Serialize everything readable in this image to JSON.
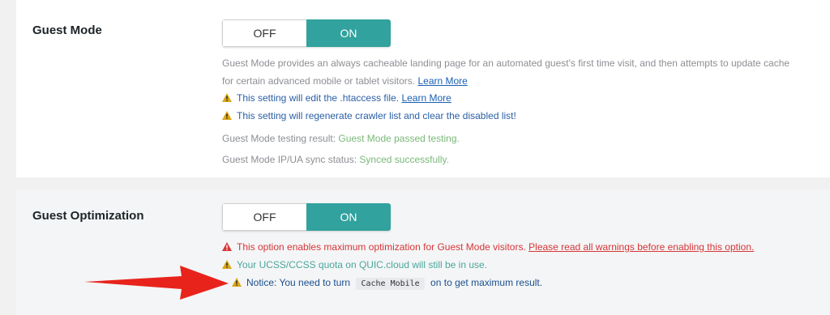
{
  "guest_mode": {
    "label": "Guest Mode",
    "toggle": {
      "off": "OFF",
      "on": "ON",
      "selected": "ON"
    },
    "desc_line1": "Guest Mode provides an always cacheable landing page for an automated guest's first time visit, and then attempts to update cache",
    "desc_line2": "for certain advanced mobile or tablet visitors.",
    "learn_more_1": "Learn More",
    "warn1_text": "This setting will edit the .htaccess file.",
    "learn_more_2": "Learn More",
    "warn2_text": "This setting will regenerate crawler list and clear the disabled list!",
    "testing_label": "Guest Mode testing result:",
    "testing_value": "Guest Mode passed testing.",
    "sync_label": "Guest Mode IP/UA sync status:",
    "sync_value": "Synced successfully."
  },
  "guest_optimization": {
    "label": "Guest Optimization",
    "toggle": {
      "off": "OFF",
      "on": "ON",
      "selected": "ON"
    },
    "danger_text": "This option enables maximum optimization for Guest Mode visitors.",
    "danger_link": "Please read all warnings before enabling this option.",
    "quota_text": "Your UCSS/CCSS quota on QUIC.cloud will still be in use.",
    "notice_prefix": "Notice: You need to turn",
    "notice_code": "Cache Mobile",
    "notice_suffix": "on to get maximum result."
  },
  "colors": {
    "toggle_on": "#31a29d",
    "danger": "#d63638",
    "success": "#7ab879",
    "warning_icon": "#dba617",
    "arrow": "#e8231c"
  },
  "icons": [
    "warning-icon",
    "danger-icon",
    "arrow-annotation"
  ]
}
